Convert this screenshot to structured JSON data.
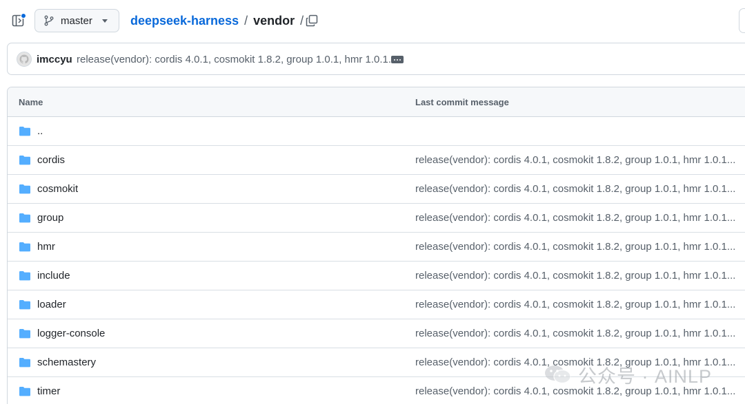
{
  "header": {
    "branch": "master",
    "breadcrumb": {
      "repo": "deepseek-harness",
      "separator": "/",
      "current": "vendor",
      "trailing": "/"
    }
  },
  "commit": {
    "author": "imccyu",
    "message": "release(vendor): cordis 4.0.1, cosmokit 1.8.2, group 1.0.1, hmr 1.0.1..."
  },
  "table": {
    "headers": {
      "name": "Name",
      "last_commit": "Last commit message"
    },
    "parent": "..",
    "rows": [
      {
        "name": "cordis",
        "message": "release(vendor): cordis 4.0.1, cosmokit 1.8.2, group 1.0.1, hmr 1.0.1..."
      },
      {
        "name": "cosmokit",
        "message": "release(vendor): cordis 4.0.1, cosmokit 1.8.2, group 1.0.1, hmr 1.0.1..."
      },
      {
        "name": "group",
        "message": "release(vendor): cordis 4.0.1, cosmokit 1.8.2, group 1.0.1, hmr 1.0.1..."
      },
      {
        "name": "hmr",
        "message": "release(vendor): cordis 4.0.1, cosmokit 1.8.2, group 1.0.1, hmr 1.0.1..."
      },
      {
        "name": "include",
        "message": "release(vendor): cordis 4.0.1, cosmokit 1.8.2, group 1.0.1, hmr 1.0.1..."
      },
      {
        "name": "loader",
        "message": "release(vendor): cordis 4.0.1, cosmokit 1.8.2, group 1.0.1, hmr 1.0.1..."
      },
      {
        "name": "logger-console",
        "message": "release(vendor): cordis 4.0.1, cosmokit 1.8.2, group 1.0.1, hmr 1.0.1..."
      },
      {
        "name": "schemastery",
        "message": "release(vendor): cordis 4.0.1, cosmokit 1.8.2, group 1.0.1, hmr 1.0.1..."
      },
      {
        "name": "timer",
        "message": "release(vendor): cordis 4.0.1, cosmokit 1.8.2, group 1.0.1, hmr 1.0.1..."
      }
    ]
  },
  "watermark": {
    "text": "公众号 · AINLP"
  },
  "icons": {
    "sidebar_toggle": "sidebar-toggle-icon",
    "branch": "git-branch-icon",
    "copy": "copy-icon",
    "folder": "folder-icon",
    "avatar": "github-avatar",
    "ellipsis": "ellipsis-icon",
    "watermark_logo": "wechat-logo"
  },
  "colors": {
    "link": "#0969da",
    "folder": "#54aeff",
    "border": "#d0d7de",
    "header_bg": "#f6f8fa",
    "muted_text": "#57606a",
    "notification_dot": "#0969da"
  }
}
